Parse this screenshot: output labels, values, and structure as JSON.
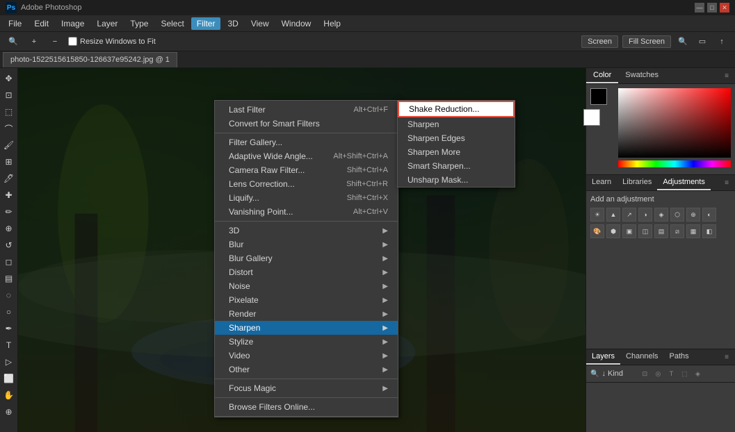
{
  "app": {
    "title": "Adobe Photoshop",
    "ps_logo": "Ps",
    "file_name": "photo-1522515615850-126637e95242.jpg @ 1"
  },
  "title_bar": {
    "controls": [
      "—",
      "□",
      "✕"
    ]
  },
  "menu_bar": {
    "items": [
      "File",
      "Edit",
      "Image",
      "Layer",
      "Type",
      "Select",
      "Filter",
      "3D",
      "View",
      "Window",
      "Help"
    ],
    "active": "Filter"
  },
  "options_bar": {
    "resize_label": "Resize Windows to Fit",
    "screen_buttons": [
      "Screen",
      "Fill Screen"
    ]
  },
  "tab_bar": {
    "file_tab": "photo-1522515615850-126637e95242.jpg @ 1"
  },
  "filter_menu": {
    "last_filter": "Last Filter",
    "last_filter_shortcut": "Alt+Ctrl+F",
    "convert_smart": "Convert for Smart Filters",
    "filter_gallery": "Filter Gallery...",
    "adaptive_wide_angle": "Adaptive Wide Angle...",
    "adaptive_shortcut": "Alt+Shift+Ctrl+A",
    "camera_raw": "Camera Raw Filter...",
    "camera_shortcut": "Shift+Ctrl+A",
    "lens_correction": "Lens Correction...",
    "lens_shortcut": "Shift+Ctrl+R",
    "liquify": "Liquify...",
    "liquify_shortcut": "Shift+Ctrl+X",
    "vanishing_point": "Vanishing Point...",
    "vanishing_shortcut": "Alt+Ctrl+V",
    "items_with_submenu": [
      "3D",
      "Blur",
      "Blur Gallery",
      "Distort",
      "Noise",
      "Pixelate",
      "Render",
      "Sharpen",
      "Stylize",
      "Video",
      "Other"
    ],
    "focus_magic": "Focus Magic",
    "browse_filters": "Browse Filters Online..."
  },
  "sharpen_submenu": {
    "items": [
      "Shake Reduction...",
      "Sharpen",
      "Sharpen Edges",
      "Sharpen More",
      "Smart Sharpen...",
      "Unsharp Mask..."
    ],
    "highlighted": "Shake Reduction..."
  },
  "color_panel": {
    "tabs": [
      "Color",
      "Swatches"
    ],
    "active_tab": "Color"
  },
  "adjustments_panel": {
    "tabs": [
      "Learn",
      "Libraries",
      "Adjustments"
    ],
    "active_tab": "Adjustments",
    "add_adjustment_label": "Add an adjustment"
  },
  "layers_panel": {
    "tabs": [
      "Layers",
      "Channels",
      "Paths"
    ],
    "active_tab": "Layers",
    "search_placeholder": "Kind",
    "search_label": "↓ Kind"
  },
  "colors": {
    "menu_highlight": "#1668a0",
    "menu_bg": "#3a3a3a",
    "shake_border": "#e74c3c",
    "active_tab_bg": "#3c8dbc"
  }
}
